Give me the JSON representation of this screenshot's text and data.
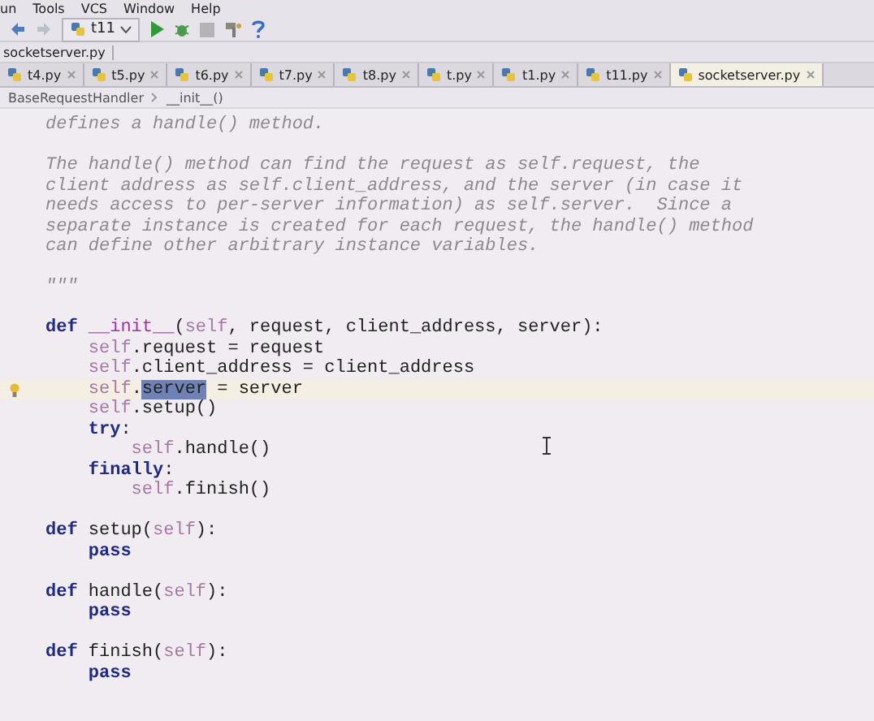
{
  "menu": [
    "un",
    "Tools",
    "VCS",
    "Window",
    "Help"
  ],
  "toolbar": {
    "run_config": "t11"
  },
  "nav": {
    "file": "socketserver.py"
  },
  "tabs": [
    {
      "label": "t4.py",
      "selected": false
    },
    {
      "label": "t5.py",
      "selected": false
    },
    {
      "label": "t6.py",
      "selected": false
    },
    {
      "label": "t7.py",
      "selected": false
    },
    {
      "label": "t8.py",
      "selected": false
    },
    {
      "label": "t.py",
      "selected": false
    },
    {
      "label": "t1.py",
      "selected": false
    },
    {
      "label": "t11.py",
      "selected": false
    },
    {
      "label": "socketserver.py",
      "selected": true
    }
  ],
  "structure": [
    "BaseRequestHandler",
    "__init__()"
  ],
  "lines": [
    {
      "current": false,
      "tokens": [
        {
          "kind": "doc",
          "text": "defines a handle() method."
        }
      ]
    },
    {
      "current": false
    },
    {
      "current": false,
      "tokens": [
        {
          "kind": "doc",
          "text": "The handle() method can find the request as self.request, the"
        }
      ]
    },
    {
      "current": false,
      "tokens": [
        {
          "kind": "doc",
          "text": "client address as self.client_address, and the server (in case it"
        }
      ]
    },
    {
      "current": false,
      "tokens": [
        {
          "kind": "doc",
          "text": "needs access to per-server information) as self.server.  Since a"
        }
      ]
    },
    {
      "current": false,
      "tokens": [
        {
          "kind": "doc",
          "text": "separate instance is created for each request, the handle() method"
        }
      ]
    },
    {
      "current": false,
      "tokens": [
        {
          "kind": "doc",
          "text": "can define other arbitrary instance variables."
        }
      ]
    },
    {
      "current": false
    },
    {
      "current": false,
      "tokens": [
        {
          "kind": "doc",
          "text": "\"\"\""
        }
      ]
    },
    {
      "current": false
    },
    {
      "current": false,
      "tokens": [
        {
          "kind": "kw",
          "text": "def "
        },
        {
          "kind": "magic",
          "text": "__init__"
        },
        {
          "kind": "plain",
          "text": "("
        },
        {
          "kind": "self",
          "text": "self"
        },
        {
          "kind": "plain",
          "text": ", request, client_address, server):"
        }
      ]
    },
    {
      "current": false,
      "tokens": [
        {
          "kind": "self",
          "text": "    self"
        },
        {
          "kind": "plain",
          "text": ".request = request"
        }
      ]
    },
    {
      "current": false,
      "tokens": [
        {
          "kind": "self",
          "text": "    self"
        },
        {
          "kind": "plain",
          "text": ".client_address = client_address"
        }
      ]
    },
    {
      "current": true,
      "tokens": [
        {
          "kind": "self",
          "text": "    self"
        },
        {
          "kind": "plain",
          "text": "."
        },
        {
          "kind": "selected",
          "text": "server"
        },
        {
          "kind": "plain",
          "text": " = server"
        }
      ]
    },
    {
      "current": false,
      "tokens": [
        {
          "kind": "self",
          "text": "    self"
        },
        {
          "kind": "plain",
          "text": ".setup()"
        }
      ]
    },
    {
      "current": false,
      "tokens": [
        {
          "kind": "kw",
          "text": "    try"
        },
        {
          "kind": "plain",
          "text": ":"
        }
      ]
    },
    {
      "current": false,
      "tokens": [
        {
          "kind": "self",
          "text": "        self"
        },
        {
          "kind": "plain",
          "text": ".handle()"
        }
      ]
    },
    {
      "current": false,
      "tokens": [
        {
          "kind": "kw",
          "text": "    finally"
        },
        {
          "kind": "plain",
          "text": ":"
        }
      ]
    },
    {
      "current": false,
      "tokens": [
        {
          "kind": "self",
          "text": "        self"
        },
        {
          "kind": "plain",
          "text": ".finish()"
        }
      ]
    },
    {
      "current": false
    },
    {
      "current": false,
      "tokens": [
        {
          "kind": "kw",
          "text": "def "
        },
        {
          "kind": "plain",
          "text": "setup("
        },
        {
          "kind": "self",
          "text": "self"
        },
        {
          "kind": "plain",
          "text": "):"
        }
      ]
    },
    {
      "current": false,
      "tokens": [
        {
          "kind": "kw",
          "text": "    pass"
        }
      ]
    },
    {
      "current": false
    },
    {
      "current": false,
      "tokens": [
        {
          "kind": "kw",
          "text": "def "
        },
        {
          "kind": "plain",
          "text": "handle("
        },
        {
          "kind": "self",
          "text": "self"
        },
        {
          "kind": "plain",
          "text": "):"
        }
      ]
    },
    {
      "current": false,
      "tokens": [
        {
          "kind": "kw",
          "text": "    pass"
        }
      ]
    },
    {
      "current": false
    },
    {
      "current": false,
      "tokens": [
        {
          "kind": "kw",
          "text": "def "
        },
        {
          "kind": "plain",
          "text": "finish("
        },
        {
          "kind": "self",
          "text": "self"
        },
        {
          "kind": "plain",
          "text": "):"
        }
      ]
    },
    {
      "current": false,
      "tokens": [
        {
          "kind": "kw",
          "text": "    pass"
        }
      ]
    }
  ]
}
